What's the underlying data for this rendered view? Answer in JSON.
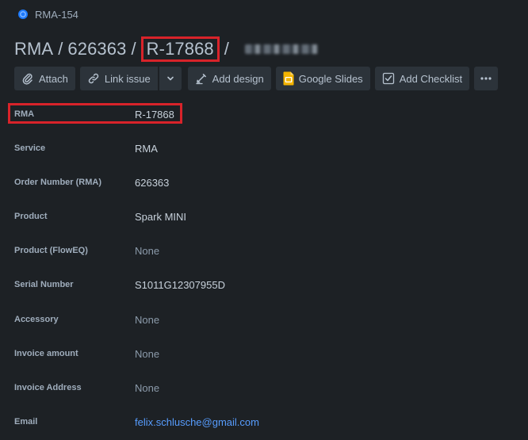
{
  "breadcrumb": {
    "issue_key": "RMA-154"
  },
  "title": {
    "part1": "RMA",
    "part2": "626363",
    "part3": "R-17868",
    "separator": "/"
  },
  "toolbar": {
    "attach": "Attach",
    "link_issue": "Link issue",
    "add_design": "Add design",
    "google_slides": "Google Slides",
    "add_checklist": "Add Checklist"
  },
  "fields": [
    {
      "label": "RMA",
      "value": "R-17868"
    },
    {
      "label": "Service",
      "value": "RMA"
    },
    {
      "label": "Order Number (RMA)",
      "value": "626363"
    },
    {
      "label": "Product",
      "value": "Spark MINI"
    },
    {
      "label": "Product (FlowEQ)",
      "value": "None"
    },
    {
      "label": "Serial Number",
      "value": "S1011G12307955D"
    },
    {
      "label": "Accessory",
      "value": "None"
    },
    {
      "label": "Invoice amount",
      "value": "None"
    },
    {
      "label": "Invoice Address",
      "value": "None"
    },
    {
      "label": "Email",
      "value": "felix.schlusche@gmail.com"
    }
  ],
  "colors": {
    "background": "#1d2125",
    "highlight": "#d8232a",
    "link": "#579dff",
    "button": "#2c333a"
  }
}
